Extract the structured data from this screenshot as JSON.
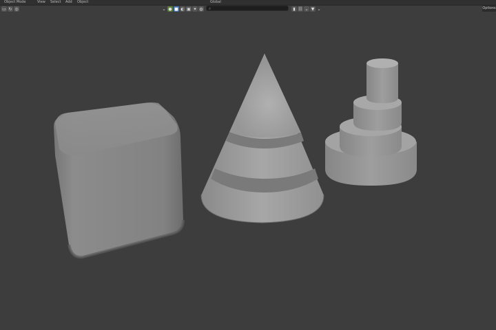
{
  "header": {
    "mode_label": "Object Mode",
    "menus": [
      "View",
      "Select",
      "Add",
      "Object"
    ],
    "orientation_label": "Global",
    "options_label": "Options"
  },
  "outliner": {
    "search_placeholder": ""
  },
  "scene": {
    "objects": [
      "Cube",
      "Cone",
      "Tiered Cylinder"
    ]
  }
}
